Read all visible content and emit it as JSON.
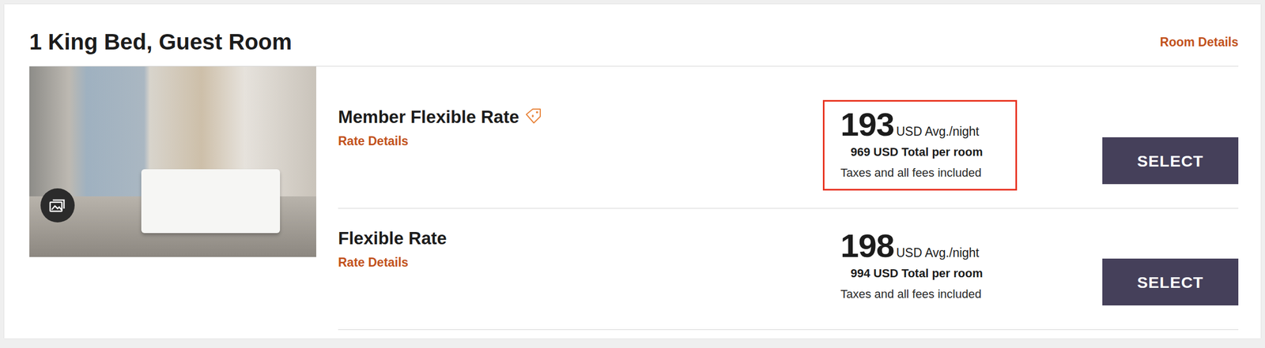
{
  "room": {
    "title": "1 King Bed, Guest Room",
    "details_link": "Room Details"
  },
  "rates": [
    {
      "name": "Member Flexible Rate",
      "member": true,
      "details_link": "Rate Details",
      "nightly": "193",
      "nightly_unit": "USD Avg./night",
      "total": "969 USD Total per room",
      "note": "Taxes and all fees included",
      "button": "SELECT",
      "highlighted": true
    },
    {
      "name": "Flexible Rate",
      "member": false,
      "details_link": "Rate Details",
      "nightly": "198",
      "nightly_unit": "USD Avg./night",
      "total": "994 USD Total per room",
      "note": "Taxes and all fees included",
      "button": "SELECT",
      "highlighted": false
    }
  ]
}
